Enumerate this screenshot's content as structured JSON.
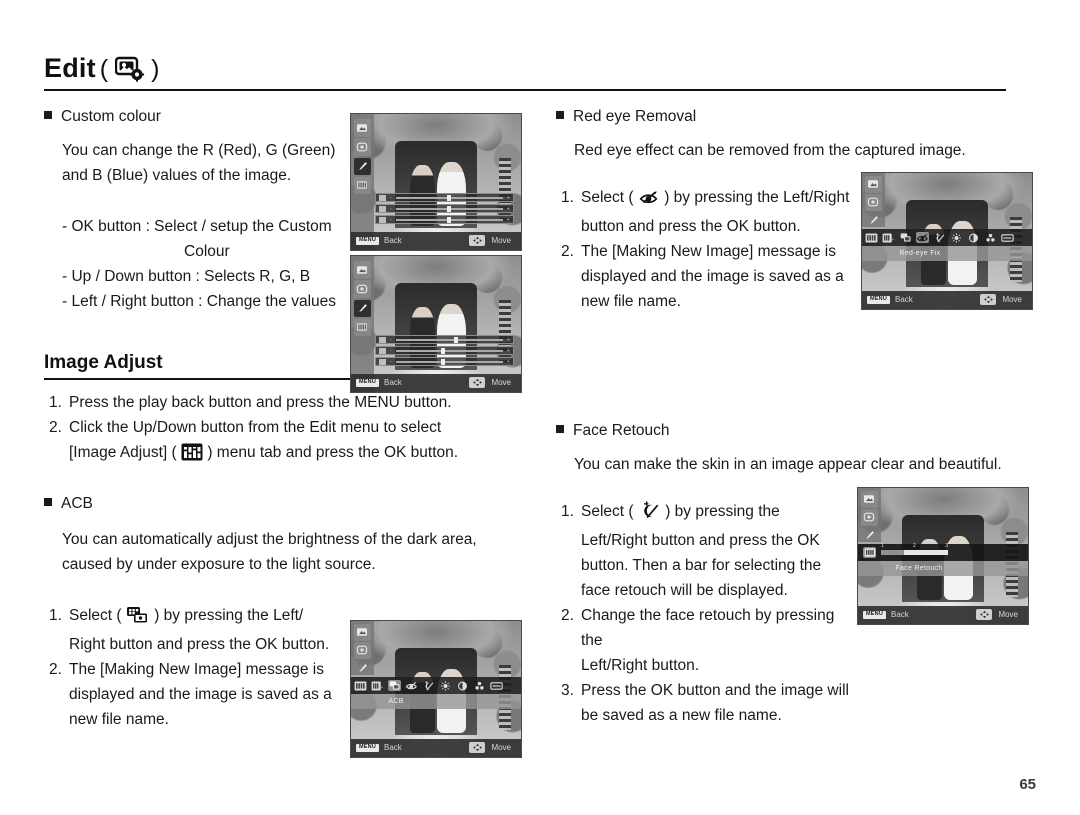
{
  "header": {
    "title": "Edit",
    "paren_open": "(",
    "paren_close": ")",
    "icon": "edit-photo-gear-icon"
  },
  "left_column": {
    "custom_colour": {
      "heading": "Custom colour",
      "description_line1": "You can change the R (Red), G (Green)",
      "description_line2": "and B (Blue) values of the image.",
      "bullets": [
        "- OK button : Select / setup the Custom",
        "Colour",
        "- Up / Down button  : Selects R, G, B",
        "- Left / Right button  : Change the values"
      ]
    },
    "image_adjust": {
      "section_title": "Image Adjust",
      "steps": [
        {
          "n": "1.",
          "text": "Press the play back button and press the MENU button."
        },
        {
          "n": "2.",
          "text": "Click the Up/Down button from the Edit menu to select"
        }
      ],
      "step2_cont_pre": "[Image Adjust] (",
      "step2_cont_post": ") menu tab and press the OK button.",
      "step2_icon": "image-adjust-icon"
    },
    "acb": {
      "heading": "ACB",
      "description_line1": "You can automatically adjust the brightness of the dark area,",
      "description_line2": "caused by under exposure to the light source.",
      "step1_n": "1.",
      "step1_pre": "Select (",
      "step1_icon": "acb-icon",
      "step1_post": ") by pressing the Left/",
      "step1_cont": "Right button and press the OK button.",
      "step2_n": "2.",
      "step2_text": "The [Making New Image] message is",
      "step2_cont1": "displayed and the image is saved as a",
      "step2_cont2": "new file name."
    }
  },
  "right_column": {
    "red_eye": {
      "heading": "Red eye Removal",
      "description": "Red eye effect can be removed from the captured image.",
      "step1_n": "1.",
      "step1_pre": "Select (",
      "step1_icon": "red-eye-icon",
      "step1_post": ") by pressing the Left/Right",
      "step1_cont": "button and press the OK button.",
      "step2_n": "2.",
      "step2_text": "The [Making New Image] message is",
      "step2_cont1": "displayed and the image is saved as a",
      "step2_cont2": "new file name."
    },
    "face_retouch": {
      "heading": "Face Retouch",
      "description": "You can make the skin in an image appear clear and beautiful.",
      "step1_n": "1.",
      "step1_pre": "Select (",
      "step1_icon": "face-retouch-icon",
      "step1_post": ") by pressing the",
      "step1_cont1": "Left/Right button and press the OK",
      "step1_cont2": "button. Then a bar for selecting the",
      "step1_cont3": "face retouch will be displayed.",
      "step2_n": "2.",
      "step2_text": "Change the face retouch by pressing the",
      "step2_cont1": "Left/Right button.",
      "step3_n": "3.",
      "step3_text": "Press the OK button and the image will",
      "step3_cont1": "be saved as a new file name."
    }
  },
  "screenshots": {
    "custom_colour_1": {
      "name": "custom-colour-screen-1",
      "back_button": "MENU",
      "back_label": "Back",
      "move_label": "Move",
      "side_icons": [
        "resize-icon",
        "rotate-icon",
        "brush-icon",
        "image-adjust-icon"
      ],
      "selected_side_index": 2,
      "slider_rows": [
        {
          "tag": "R",
          "value": 50
        },
        {
          "tag": "G",
          "value": 50
        },
        {
          "tag": "B",
          "value": 50
        }
      ]
    },
    "custom_colour_2": {
      "name": "custom-colour-screen-2",
      "back_button": "MENU",
      "back_label": "Back",
      "move_label": "Move",
      "side_icons": [
        "resize-icon",
        "rotate-icon",
        "brush-icon",
        "image-adjust-icon"
      ],
      "selected_side_index": 2,
      "slider_rows": [
        {
          "tag": "R",
          "value": 56
        },
        {
          "tag": "G",
          "value": 44
        },
        {
          "tag": "B",
          "value": 44
        }
      ]
    },
    "acb": {
      "name": "acb-screen",
      "back_button": "MENU",
      "back_label": "Back",
      "move_label": "Move",
      "mode_label": "ACB",
      "side_icons": [
        "resize-icon",
        "rotate-icon",
        "brush-icon"
      ],
      "bar_icons": [
        "image-adjust-icon",
        "brightness-icon",
        "acb-icon",
        "red-eye-icon",
        "face-retouch-icon",
        "sun-icon",
        "contrast-icon",
        "saturation-icon",
        "noise-icon"
      ],
      "selected_bar_index": 2
    },
    "red_eye": {
      "name": "red-eye-fix-screen",
      "back_button": "MENU",
      "back_label": "Back",
      "move_label": "Move",
      "mode_label": "Red-eye Fix",
      "side_icons": [
        "resize-icon",
        "rotate-icon",
        "brush-icon"
      ],
      "bar_icons": [
        "image-adjust-icon",
        "brightness-icon",
        "acb-icon",
        "red-eye-icon",
        "face-retouch-icon",
        "sun-icon",
        "contrast-icon",
        "saturation-icon",
        "noise-icon"
      ],
      "selected_bar_index": 3
    },
    "face_retouch": {
      "name": "face-retouch-screen",
      "back_button": "MENU",
      "back_label": "Back",
      "move_label": "Move",
      "mode_label": "Face Retouch",
      "side_icons": [
        "resize-icon",
        "rotate-icon",
        "brush-icon"
      ],
      "scale_ticks": [
        "1",
        "2",
        "3"
      ],
      "scale_value": 1
    }
  },
  "footer": {
    "page_number": "65"
  }
}
